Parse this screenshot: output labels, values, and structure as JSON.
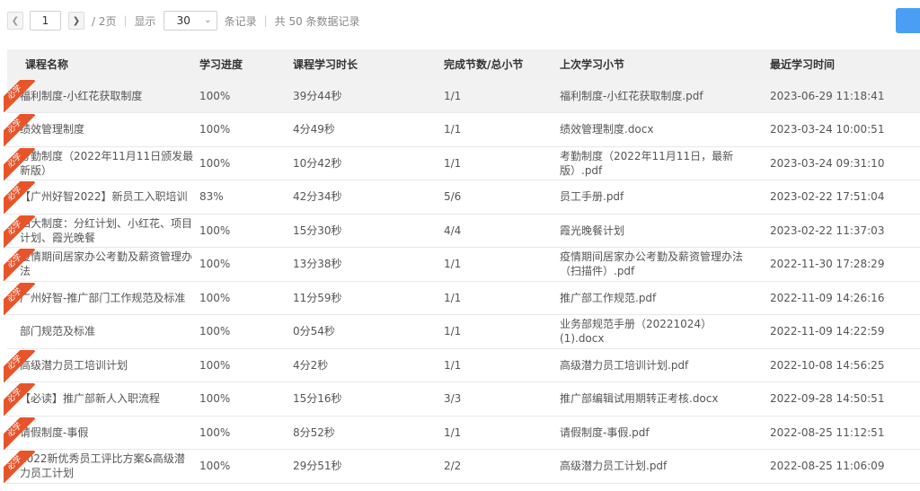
{
  "pager": {
    "prev_icon": "chevron-left-icon",
    "next_icon": "chevron-right-icon",
    "page": "1",
    "pages_text": "/ 2页",
    "show_label": "显示",
    "page_size": "30",
    "records_label": "条记录",
    "total_text": "共 50 条数据记录"
  },
  "badge_label": "必学",
  "colors": {
    "accent": "#4a9ff5",
    "badge": "#e8542a",
    "header_bg": "#f1f1f1"
  },
  "table": {
    "headers": [
      "课程名称",
      "学习进度",
      "课程学习时长",
      "完成节数/总小节",
      "上次学习小节",
      "最近学习时间"
    ],
    "rows": [
      {
        "name": "福利制度-小红花获取制度",
        "progress": "100%",
        "duration": "39分44秒",
        "sections": "1/1",
        "last": "福利制度-小红花获取制度.pdf",
        "time": "2023-06-29 11:18:41",
        "required": true
      },
      {
        "name": "绩效管理制度",
        "progress": "100%",
        "duration": "4分49秒",
        "sections": "1/1",
        "last": "绩效管理制度.docx",
        "time": "2023-03-24 10:00:51",
        "required": true
      },
      {
        "name": "考勤制度（2022年11月11日颁发最新版）",
        "progress": "100%",
        "duration": "10分42秒",
        "sections": "1/1",
        "last": "考勤制度（2022年11月11日，最新版）.pdf",
        "time": "2023-03-24 09:31:10",
        "required": true
      },
      {
        "name": "【广州好智2022】新员工入职培训",
        "progress": "83%",
        "duration": "42分34秒",
        "sections": "5/6",
        "last": "员工手册.pdf",
        "time": "2023-02-22 17:51:04",
        "required": true
      },
      {
        "name": "四大制度：分红计划、小红花、项目计划、霞光晚餐",
        "progress": "100%",
        "duration": "15分30秒",
        "sections": "4/4",
        "last": "霞光晚餐计划",
        "time": "2023-02-22 11:37:03",
        "required": true
      },
      {
        "name": "疫情期间居家办公考勤及薪资管理办法",
        "progress": "100%",
        "duration": "13分38秒",
        "sections": "1/1",
        "last": "疫情期间居家办公考勤及薪资管理办法（扫描件）.pdf",
        "time": "2022-11-30 17:28:29",
        "required": true
      },
      {
        "name": "广州好智-推广部门工作规范及标准",
        "progress": "100%",
        "duration": "11分59秒",
        "sections": "1/1",
        "last": "推广部工作规范.pdf",
        "time": "2022-11-09 14:26:16",
        "required": true
      },
      {
        "name": "部门规范及标准",
        "progress": "100%",
        "duration": "0分54秒",
        "sections": "1/1",
        "last": "业务部规范手册（20221024）(1).docx",
        "time": "2022-11-09 14:22:59",
        "required": false
      },
      {
        "name": "高级潜力员工培训计划",
        "progress": "100%",
        "duration": "4分2秒",
        "sections": "1/1",
        "last": "高级潜力员工培训计划.pdf",
        "time": "2022-10-08 14:56:25",
        "required": true
      },
      {
        "name": "【必读】推广部新人入职流程",
        "progress": "100%",
        "duration": "15分16秒",
        "sections": "3/3",
        "last": "推广部编辑试用期转正考核.docx",
        "time": "2022-09-28 14:50:51",
        "required": true
      },
      {
        "name": "请假制度-事假",
        "progress": "100%",
        "duration": "8分52秒",
        "sections": "1/1",
        "last": "请假制度-事假.pdf",
        "time": "2022-08-25 11:12:51",
        "required": true
      },
      {
        "name": "2022新优秀员工评比方案&高级潜力员工计划",
        "progress": "100%",
        "duration": "29分51秒",
        "sections": "2/2",
        "last": "高级潜力员工计划.pdf",
        "time": "2022-08-25 11:06:09",
        "required": true
      }
    ]
  }
}
